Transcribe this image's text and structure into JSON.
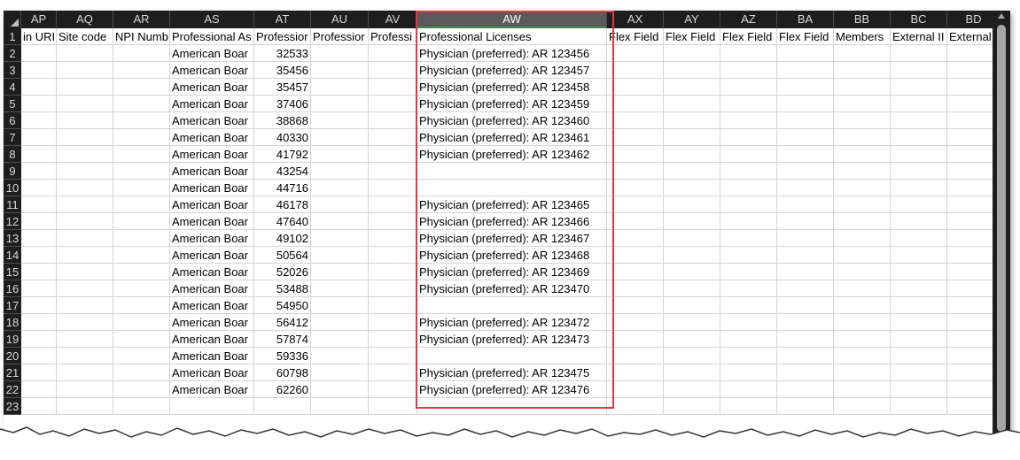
{
  "columns": [
    {
      "letter": "AP",
      "header": "in URI"
    },
    {
      "letter": "AQ",
      "header": "Site code"
    },
    {
      "letter": "AR",
      "header": "NPI Numb"
    },
    {
      "letter": "AS",
      "header": "Professional As"
    },
    {
      "letter": "AT",
      "header": "Professior"
    },
    {
      "letter": "AU",
      "header": "Professior"
    },
    {
      "letter": "AV",
      "header": "Professi"
    },
    {
      "letter": "AW",
      "header": "Professional Licenses"
    },
    {
      "letter": "AX",
      "header": "Flex Field"
    },
    {
      "letter": "AY",
      "header": "Flex Field"
    },
    {
      "letter": "AZ",
      "header": "Flex Field"
    },
    {
      "letter": "BA",
      "header": "Flex Field"
    },
    {
      "letter": "BB",
      "header": "Members"
    },
    {
      "letter": "BC",
      "header": "External II"
    },
    {
      "letter": "BD",
      "header": "External"
    }
  ],
  "selected_column": "AW",
  "row_numbers": [
    "1",
    "2",
    "3",
    "4",
    "5",
    "6",
    "7",
    "8",
    "9",
    "10",
    "11",
    "12",
    "13",
    "14",
    "15",
    "16",
    "17",
    "18",
    "19",
    "20",
    "21",
    "22",
    "23"
  ],
  "rows": [
    {
      "as": "American Boar",
      "at": "32533",
      "aw": "Physician (preferred): AR 123456"
    },
    {
      "as": "American Boar",
      "at": "35456",
      "aw": "Physician (preferred): AR 123457"
    },
    {
      "as": "American Boar",
      "at": "35457",
      "aw": "Physician (preferred): AR 123458"
    },
    {
      "as": "American Boar",
      "at": "37406",
      "aw": "Physician (preferred): AR 123459"
    },
    {
      "as": "American Boar",
      "at": "38868",
      "aw": "Physician (preferred): AR 123460"
    },
    {
      "as": "American Boar",
      "at": "40330",
      "aw": "Physician (preferred): AR 123461"
    },
    {
      "as": "American Boar",
      "at": "41792",
      "aw": "Physician (preferred): AR 123462"
    },
    {
      "as": "American Boar",
      "at": "43254",
      "aw": ""
    },
    {
      "as": "American Boar",
      "at": "44716",
      "aw": ""
    },
    {
      "as": "American Boar",
      "at": "46178",
      "aw": "Physician (preferred): AR 123465"
    },
    {
      "as": "American Boar",
      "at": "47640",
      "aw": "Physician (preferred): AR 123466"
    },
    {
      "as": "American Boar",
      "at": "49102",
      "aw": "Physician (preferred): AR 123467"
    },
    {
      "as": "American Boar",
      "at": "50564",
      "aw": "Physician (preferred): AR 123468"
    },
    {
      "as": "American Boar",
      "at": "52026",
      "aw": "Physician (preferred): AR 123469"
    },
    {
      "as": "American Boar",
      "at": "53488",
      "aw": "Physician (preferred): AR 123470"
    },
    {
      "as": "American Boar",
      "at": "54950",
      "aw": ""
    },
    {
      "as": "American Boar",
      "at": "56412",
      "aw": "Physician (preferred): AR 123472"
    },
    {
      "as": "American Boar",
      "at": "57874",
      "aw": "Physician (preferred): AR 123473"
    },
    {
      "as": "American Boar",
      "at": "59336",
      "aw": ""
    },
    {
      "as": "American Boar",
      "at": "60798",
      "aw": "Physician (preferred): AR 123475"
    },
    {
      "as": "American Boar",
      "at": "62260",
      "aw": "Physician (preferred): AR 123476"
    }
  ],
  "colors": {
    "header_bg": "#1e1e1e",
    "selected_header_bg": "#5a5a5a",
    "highlight_border": "#e0393e",
    "gridline": "#d4d4d4"
  },
  "icons": {
    "corner": "select-all-triangle-icon",
    "scroll_up": "scroll-up-arrow-icon"
  }
}
